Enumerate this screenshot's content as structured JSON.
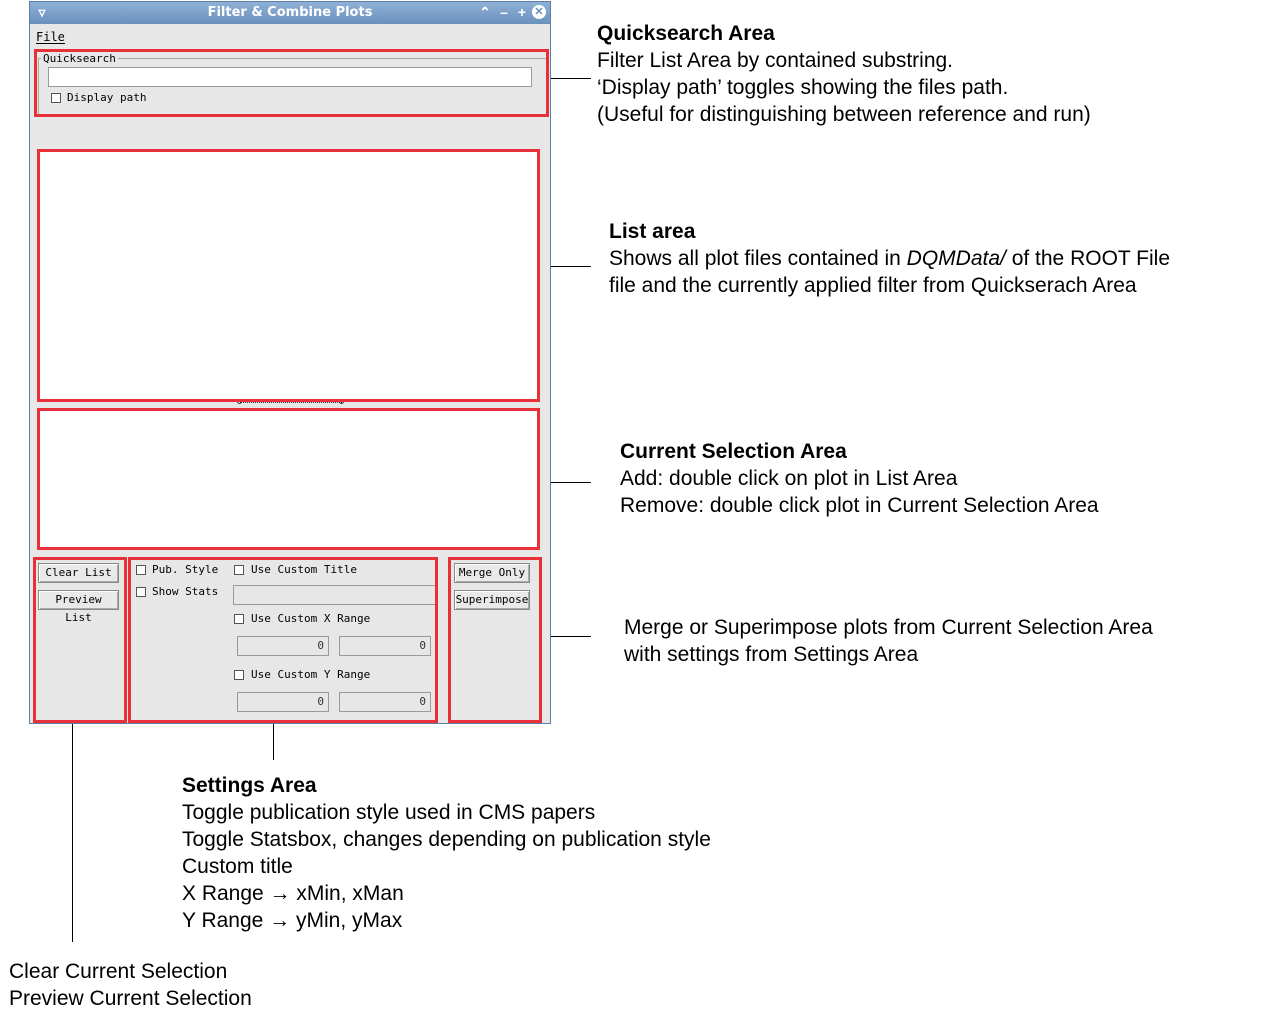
{
  "window": {
    "title": "Filter & Combine Plots",
    "menu_file": "File",
    "quicksearch": {
      "legend": "Quicksearch",
      "value": "",
      "display_path_label": "Display path",
      "display_path_checked": false
    },
    "buttons": {
      "clear_list": "Clear List",
      "preview_list": "Preview List",
      "merge_only": "Merge Only",
      "superimpose": "Superimpose"
    },
    "settings": {
      "pub_style": "Pub. Style",
      "show_stats": "Show Stats",
      "use_custom_title": "Use Custom Title",
      "custom_title_value": "",
      "use_custom_x_range": "Use Custom X Range",
      "x_min": "0",
      "x_max": "0",
      "use_custom_y_range": "Use Custom Y Range",
      "y_min": "0",
      "y_max": "0"
    }
  },
  "annotations": {
    "quicksearch": {
      "heading": "Quicksearch Area",
      "lines": [
        "Filter List Area by contained substring.",
        "‘Display path’ toggles showing the files path.",
        "(Useful for distinguishing between reference and run)"
      ]
    },
    "list": {
      "heading": "List area",
      "line1_pre": "Shows all plot files contained in ",
      "line1_italic": "DQMData/",
      "line1_post": " of the ROOT File",
      "line2": "file and the currently applied filter from Quickserach Area"
    },
    "selection": {
      "heading": "Current Selection Area",
      "lines": [
        "Add: double click on plot in List Area",
        "Remove: double click plot in Current Selection Area"
      ]
    },
    "merge": {
      "lines": [
        "Merge or Superimpose plots from Current Selection Area",
        "with settings from Settings Area"
      ]
    },
    "settings": {
      "heading": "Settings Area",
      "lines": [
        "Toggle publication style used in CMS papers",
        "Toggle Statsbox, changes depending on publication style",
        "Custom title",
        "X Range → xMin, xMan",
        "Y Range → yMin, yMax"
      ]
    },
    "clear": {
      "lines": [
        "Clear Current Selection",
        "Preview Current Selection"
      ]
    }
  }
}
